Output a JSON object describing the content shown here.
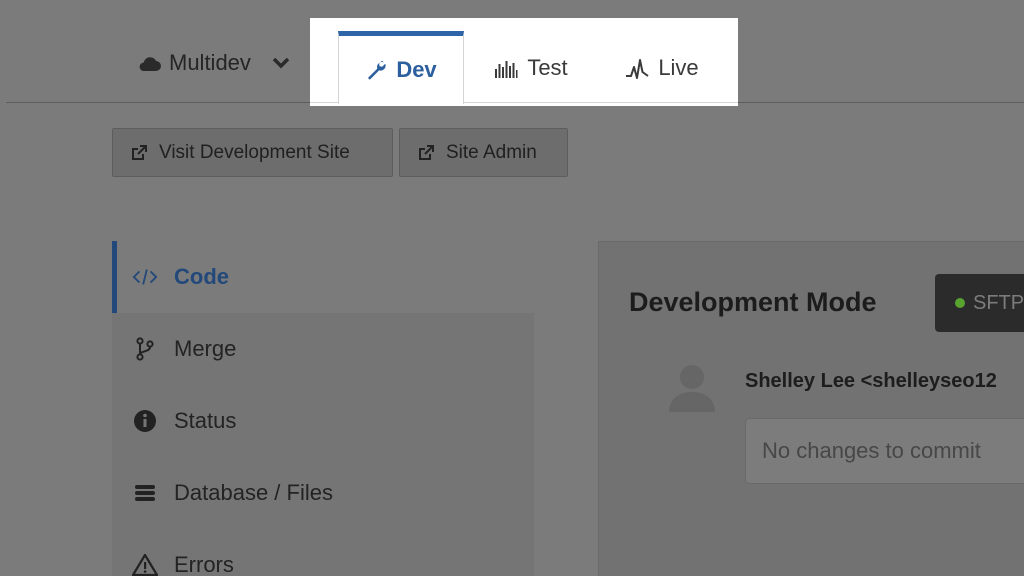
{
  "env_switcher": {
    "label": "Multidev",
    "icon": "cloud-icon"
  },
  "tabs": [
    {
      "label": "Dev",
      "icon": "wrench-icon",
      "active": true
    },
    {
      "label": "Test",
      "icon": "bar-chart-icon",
      "active": false
    },
    {
      "label": "Live",
      "icon": "pulse-icon",
      "active": false
    }
  ],
  "actions": {
    "visit_label": "Visit Development Site",
    "admin_label": "Site Admin"
  },
  "sidebar": {
    "items": [
      {
        "label": "Code",
        "icon": "code-icon",
        "active": true
      },
      {
        "label": "Merge",
        "icon": "branch-icon",
        "active": false
      },
      {
        "label": "Status",
        "icon": "info-icon",
        "active": false
      },
      {
        "label": "Database / Files",
        "icon": "database-icon",
        "active": false
      },
      {
        "label": "Errors",
        "icon": "warning-icon",
        "active": false
      }
    ]
  },
  "main": {
    "title": "Development Mode",
    "mode_button": "SFTP",
    "author": "Shelley Lee <shelleyseo12",
    "commit_placeholder": "No changes to commit"
  },
  "colors": {
    "accent": "#2E64A8",
    "status_dot": "#58A330"
  }
}
